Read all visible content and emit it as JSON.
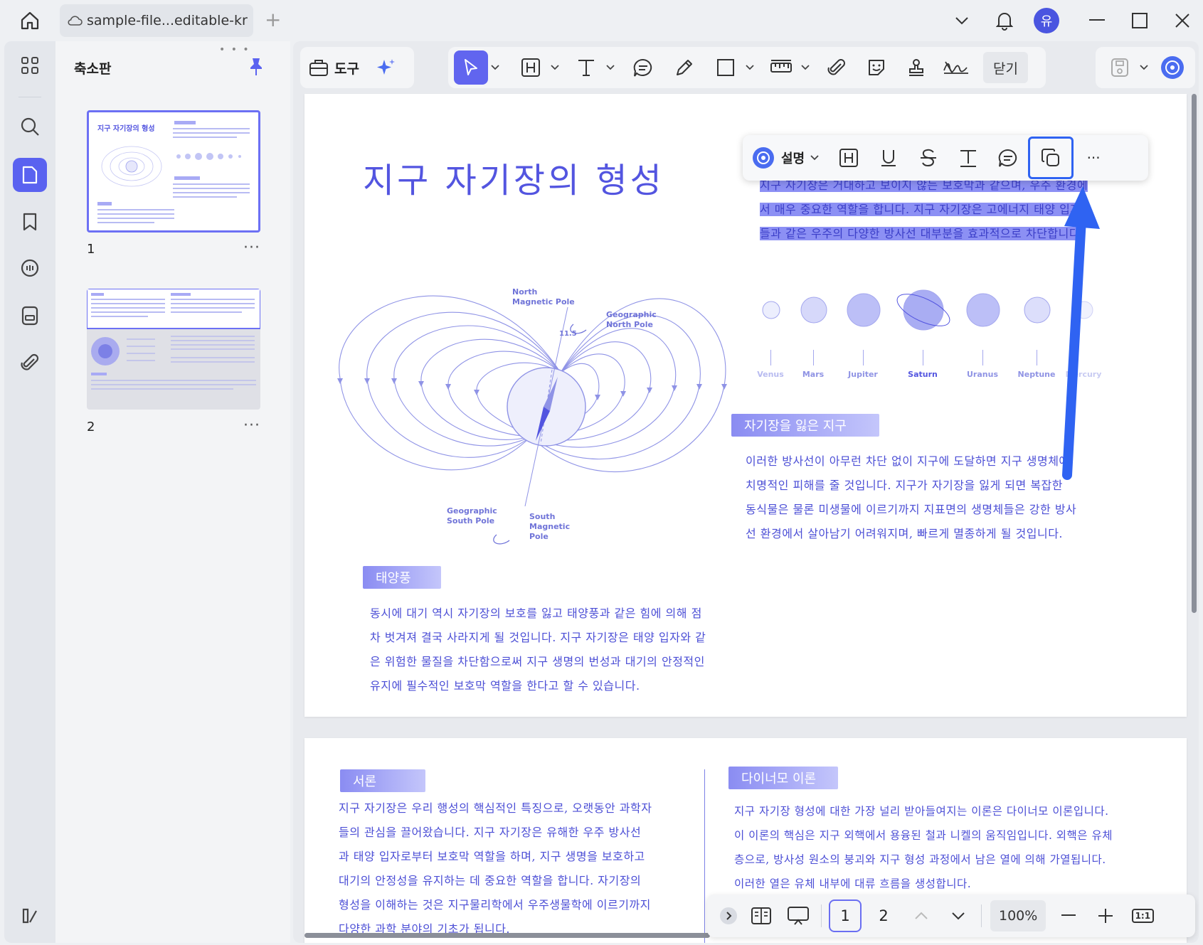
{
  "tab": {
    "title": "sample-file...editable-kr"
  },
  "thumbnail_panel": {
    "title": "축소판",
    "pages": [
      {
        "number": "1"
      },
      {
        "number": "2"
      }
    ],
    "more": "···"
  },
  "toolbar": {
    "tool_label": "도구",
    "close_label": "닫기"
  },
  "floating_toolbar": {
    "ai_label": "설명",
    "more": "···"
  },
  "page1": {
    "title": "지구 자기장의 형성",
    "highlighted_lines": [
      "지구 자기장은 거대하고 보이지 않는 보호막과 같으며, 우주 환경에",
      "서 매우 중요한 역할을 합니다. 지구 자기장은 고에너지 태양 입자",
      "들과 같은 우주의 다양한 방사선 대부분을 효과적으로 차단합니다."
    ],
    "diagram": {
      "north_magnetic_pole": [
        "North",
        "Magnetic Pole"
      ],
      "geographic_north_pole": [
        "Geographic",
        "North Pole"
      ],
      "angle": "11.5",
      "geographic_south_pole": [
        "Geographic",
        "South Pole"
      ],
      "south_magnetic_pole": [
        "South",
        "Magnetic",
        "Pole"
      ]
    },
    "planets": [
      "Venus",
      "Mars",
      "Jupiter",
      "Saturn",
      "Uranus",
      "Neptune",
      "Mercury"
    ],
    "section1_title": "자기장을 잃은 지구",
    "section1_lines": [
      "이러한 방사선이 아무런 차단 없이 지구에 도달하면 지구 생명체에",
      "치명적인 피해를 줄 것입니다. 지구가 자기장을 잃게 되면 복잡한",
      "동식물은 물론 미생물에 이르기까지 지표면의 생명체들은 강한 방사",
      "선 환경에서 살아남기 어려워지며, 빠르게 멸종하게 될 것입니다."
    ],
    "section2_title": "태양풍",
    "section2_lines": [
      "동시에 대기 역시 자기장의 보호를 잃고 태양풍과 같은 힘에 의해 점",
      "차 벗겨져 결국 사라지게 될 것입니다. 지구 자기장은 태양 입자와 같",
      "은 위험한 물질을 차단함으로써 지구 생명의 번성과 대기의 안정적인",
      "유지에 필수적인 보호막 역할을 한다고 할 수 있습니다."
    ]
  },
  "page2": {
    "left_title": "서론",
    "left_lines": [
      "지구 자기장은 우리 행성의 핵심적인 특징으로, 오랫동안 과학자",
      "들의 관심을 끌어왔습니다. 지구 자기장은 유해한 우주 방사선",
      "과 태양 입자로부터 보호막 역할을 하며, 지구 생명을 보호하고",
      "대기의 안정성을 유지하는 데 중요한 역할을 합니다. 자기장의",
      "형성을 이해하는 것은 지구물리학에서 우주생물학에 이르기까지",
      "다양한 과학 분야의 기초가 됩니다."
    ],
    "right_title": "다이너모 이론",
    "right_lines": [
      "지구 자기장 형성에 대한 가장 널리 받아들여지는 이론은 다이너모 이론입니다.",
      "이 이론의 핵심은 지구 외핵에서 용융된 철과 니켈의 움직임입니다. 외핵은 유체",
      "층으로, 방사성 원소의 붕괴와 지구 형성 과정에서 남은 열에 의해 가열됩니다.",
      "이러한 열은 유체 내부에 대류 흐름을 생성합니다."
    ]
  },
  "bottom_bar": {
    "page1": "1",
    "page2": "2",
    "zoom": "100%",
    "fit": "1:1"
  }
}
